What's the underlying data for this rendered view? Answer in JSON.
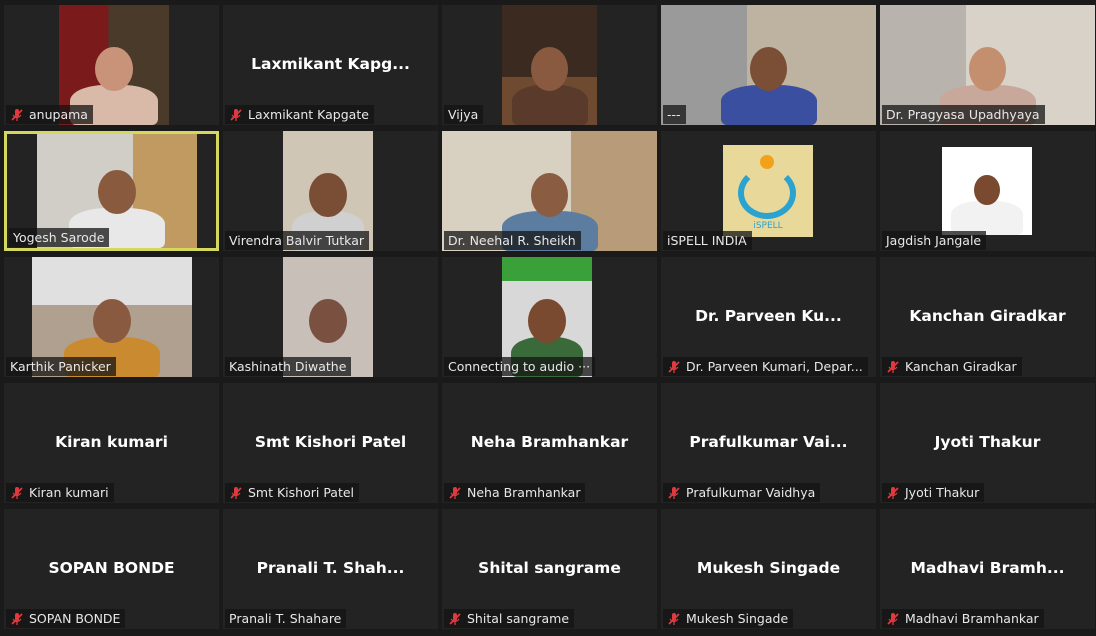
{
  "participants": [
    {
      "name": "anupama",
      "muted": true,
      "type": "video"
    },
    {
      "name": "Laxmikant Kapgate",
      "display": "Laxmikant  Kapg...",
      "muted": true,
      "type": "name"
    },
    {
      "name": "Vijya",
      "muted": false,
      "type": "video"
    },
    {
      "name": "---",
      "muted": false,
      "type": "video"
    },
    {
      "name": "Dr. Pragyasa Upadhyaya",
      "muted": false,
      "type": "video"
    },
    {
      "name": "Yogesh Sarode",
      "muted": false,
      "type": "video",
      "active_speaker": true
    },
    {
      "name": "Virendra Balvir Tutkar",
      "muted": false,
      "type": "video"
    },
    {
      "name": "Dr. Neehal R. Sheikh",
      "muted": false,
      "type": "video"
    },
    {
      "name": "iSPELL INDIA",
      "muted": false,
      "type": "video",
      "logo_text": "iSPELL"
    },
    {
      "name": "Jagdish Jangale",
      "muted": false,
      "type": "video"
    },
    {
      "name": "Karthik Panicker",
      "muted": false,
      "type": "video"
    },
    {
      "name": "Kashinath Diwathe",
      "muted": false,
      "type": "video"
    },
    {
      "name": "Connecting to audio ···",
      "muted": false,
      "type": "video"
    },
    {
      "name": "Dr. Parveen Kumari, Depar...",
      "display": "Dr. Parveen  Ku...",
      "muted": true,
      "type": "name"
    },
    {
      "name": "Kanchan Giradkar",
      "display": "Kanchan Giradkar",
      "muted": true,
      "type": "name"
    },
    {
      "name": "Kiran kumari",
      "display": "Kiran kumari",
      "muted": true,
      "type": "name"
    },
    {
      "name": "Smt Kishori Patel",
      "display": "Smt Kishori Patel",
      "muted": true,
      "type": "name"
    },
    {
      "name": "Neha Bramhankar",
      "display": "Neha Bramhankar",
      "muted": true,
      "type": "name"
    },
    {
      "name": "Prafulkumar Vaidhya",
      "display": "Prafulkumar  Vai...",
      "muted": true,
      "type": "name"
    },
    {
      "name": "Jyoti Thakur",
      "display": "Jyoti Thakur",
      "muted": true,
      "type": "name"
    },
    {
      "name": "SOPAN BONDE",
      "display": "SOPAN BONDE",
      "muted": true,
      "type": "name"
    },
    {
      "name": "Pranali  T. Shahare",
      "display": "Pranali  T. Shah...",
      "muted": false,
      "type": "name"
    },
    {
      "name": "Shital  sangrame",
      "display": "Shital  sangrame",
      "muted": true,
      "type": "name"
    },
    {
      "name": "Mukesh Singade",
      "display": "Mukesh Singade",
      "muted": true,
      "type": "name"
    },
    {
      "name": "Madhavi Bramhankar",
      "display": "Madhavi  Bramh...",
      "muted": true,
      "type": "name"
    }
  ],
  "colors": {
    "background": "#1a1a1a",
    "tile": "#232323",
    "active_border": "#d4d95e",
    "mute_icon": "#e0393e"
  },
  "icons": {
    "mute": "mic-muted-icon"
  }
}
